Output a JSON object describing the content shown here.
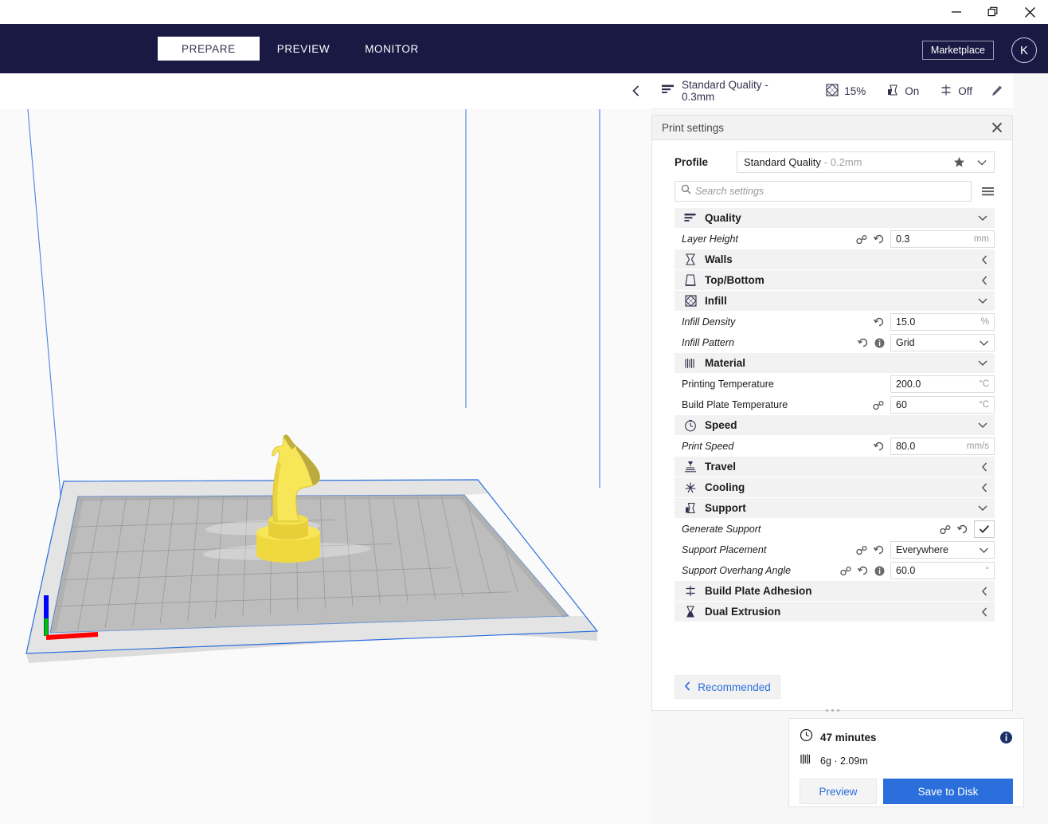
{
  "window": {
    "minimize": "minimize-icon",
    "restore": "restore-icon",
    "close": "close-icon"
  },
  "nav": {
    "tabs": [
      {
        "label": "PREPARE",
        "active": true
      },
      {
        "label": "PREVIEW",
        "active": false
      },
      {
        "label": "MONITOR",
        "active": false
      }
    ],
    "marketplace_label": "Marketplace",
    "avatar_initial": "K"
  },
  "profile_bar": {
    "quality_name": "Standard Quality - 0.3mm",
    "metrics": [
      {
        "icon": "infill-icon",
        "value": "15%"
      },
      {
        "icon": "support-icon",
        "value": "On"
      },
      {
        "icon": "adhesion-icon",
        "value": "Off"
      }
    ],
    "edit_icon": "pencil-icon"
  },
  "panel": {
    "title": "Print settings",
    "close_icon": "close-icon",
    "profile_label": "Profile",
    "profile_value": "Standard Quality",
    "profile_variant": "- 0.2mm",
    "search_placeholder": "Search settings",
    "recommended_label": "Recommended",
    "categories": [
      {
        "name": "Quality",
        "icon": "quality-icon",
        "expanded": true,
        "settings": [
          {
            "label": "Layer Height",
            "modified": true,
            "icons": [
              "link-icon",
              "revert-icon"
            ],
            "control": "input",
            "value": "0.3",
            "unit": "mm"
          }
        ]
      },
      {
        "name": "Walls",
        "icon": "walls-icon",
        "expanded": false,
        "settings": []
      },
      {
        "name": "Top/Bottom",
        "icon": "topbottom-icon",
        "expanded": false,
        "settings": []
      },
      {
        "name": "Infill",
        "icon": "infill-icon",
        "expanded": true,
        "settings": [
          {
            "label": "Infill Density",
            "modified": true,
            "icons": [
              "revert-icon"
            ],
            "control": "input",
            "value": "15.0",
            "unit": "%"
          },
          {
            "label": "Infill Pattern",
            "modified": true,
            "icons": [
              "revert-icon",
              "info-icon"
            ],
            "control": "select",
            "value": "Grid",
            "unit": ""
          }
        ]
      },
      {
        "name": "Material",
        "icon": "material-icon",
        "expanded": true,
        "settings": [
          {
            "label": "Printing Temperature",
            "modified": false,
            "icons": [],
            "control": "input",
            "value": "200.0",
            "unit": "°C"
          },
          {
            "label": "Build Plate Temperature",
            "modified": false,
            "icons": [
              "link-icon"
            ],
            "control": "input",
            "value": "60",
            "unit": "°C"
          }
        ]
      },
      {
        "name": "Speed",
        "icon": "speed-icon",
        "expanded": true,
        "settings": [
          {
            "label": "Print Speed",
            "modified": true,
            "icons": [
              "revert-icon"
            ],
            "control": "input",
            "value": "80.0",
            "unit": "mm/s"
          }
        ]
      },
      {
        "name": "Travel",
        "icon": "travel-icon",
        "expanded": false,
        "settings": []
      },
      {
        "name": "Cooling",
        "icon": "cooling-icon",
        "expanded": false,
        "settings": []
      },
      {
        "name": "Support",
        "icon": "support-icon",
        "expanded": true,
        "settings": [
          {
            "label": "Generate Support",
            "modified": true,
            "icons": [
              "link-icon",
              "revert-icon"
            ],
            "control": "checkbox",
            "value": "checked",
            "unit": ""
          },
          {
            "label": "Support Placement",
            "modified": true,
            "icons": [
              "link-icon",
              "revert-icon"
            ],
            "control": "select",
            "value": "Everywhere",
            "unit": ""
          },
          {
            "label": "Support Overhang Angle",
            "modified": true,
            "icons": [
              "link-icon",
              "revert-icon",
              "info-icon"
            ],
            "control": "input",
            "value": "60.0",
            "unit": "°"
          }
        ]
      },
      {
        "name": "Build Plate Adhesion",
        "icon": "adhesion-icon",
        "expanded": false,
        "settings": []
      },
      {
        "name": "Dual Extrusion",
        "icon": "dualextrusion-icon",
        "expanded": false,
        "settings": []
      }
    ]
  },
  "job": {
    "time_icon": "clock-icon",
    "time": "47 minutes",
    "material_icon": "material-icon",
    "material": "6g · 2.09m",
    "info_icon": "info-icon",
    "preview_label": "Preview",
    "save_label": "Save to Disk"
  },
  "viewport": {
    "model": "chess-knight",
    "model_color": "#f5e049",
    "buildplate_color": "#b9b9b9",
    "outline_color": "#2a6fdb",
    "axis_x_color": "#ff0000",
    "axis_y_color": "#00c000",
    "axis_z_color": "#0000ff"
  },
  "colors": {
    "nav_bg": "#191944",
    "accent": "#2a6fdb",
    "panel_bg": "#ffffff",
    "category_bg": "#f2f2f2"
  }
}
